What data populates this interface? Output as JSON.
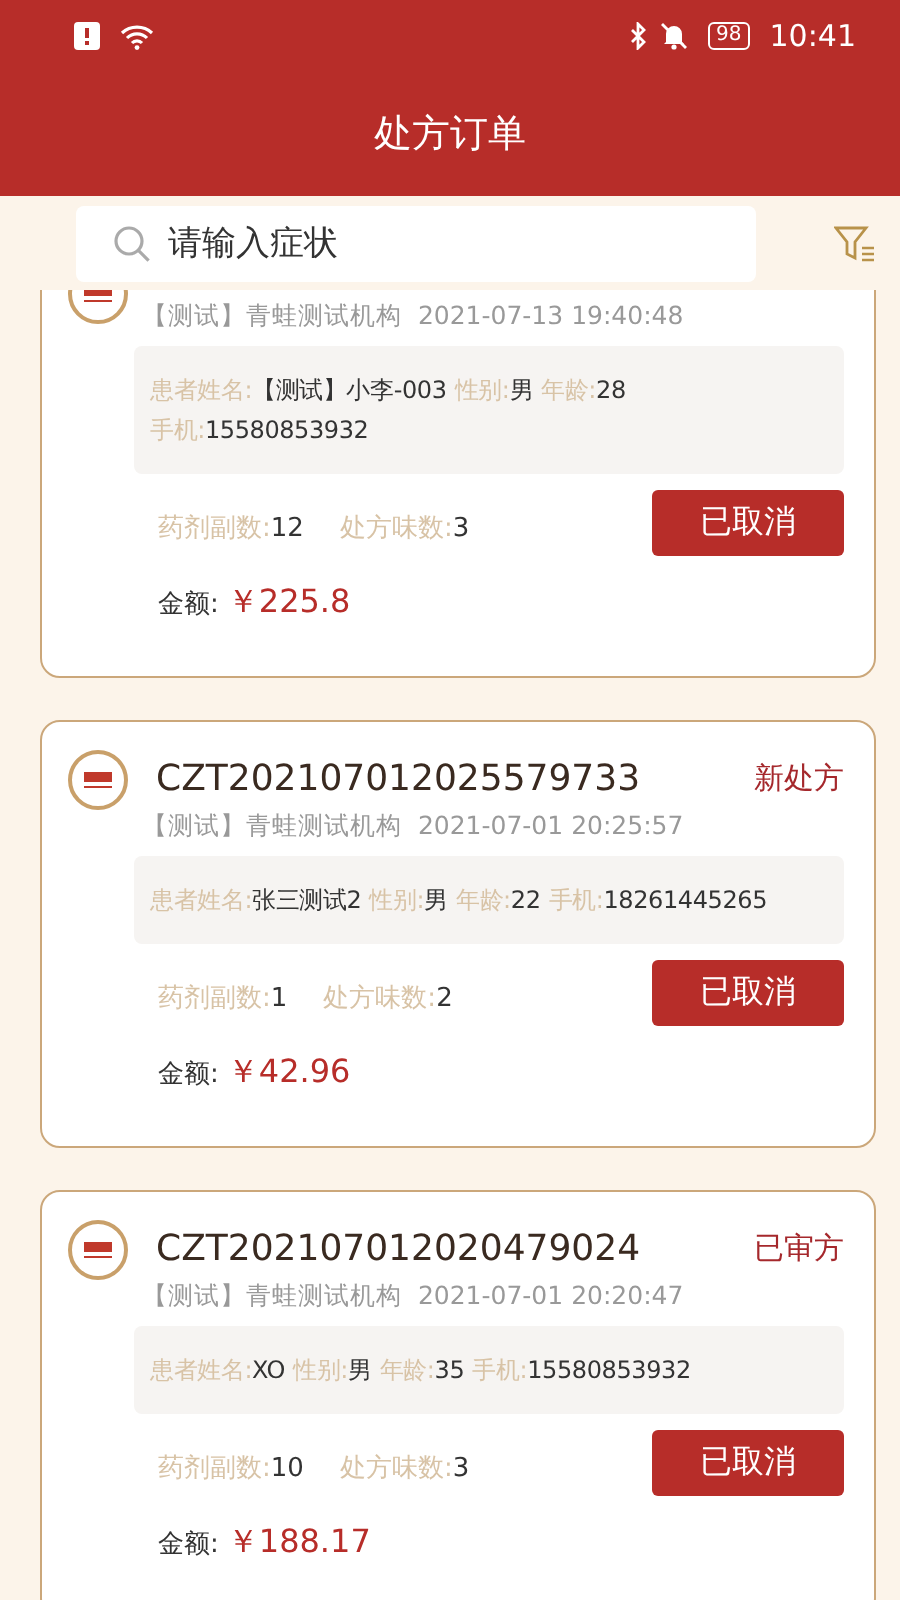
{
  "status_bar": {
    "battery": "98",
    "time": "10:41"
  },
  "header": {
    "title": "处方订单"
  },
  "search": {
    "placeholder": "请输入症状"
  },
  "orders": [
    {
      "org": "【测试】青蛙测试机构",
      "time": "2021-07-13 19:40:48",
      "patient": [
        {
          "label": "患者姓名:",
          "value": "【测试】小李-003"
        },
        {
          "label": "性别:",
          "value": "男"
        },
        {
          "label": "年龄:",
          "value": "28"
        },
        {
          "label": "手机:",
          "value": "15580853932"
        }
      ],
      "counts": [
        {
          "label": "药剂副数:",
          "value": "12"
        },
        {
          "label": "处方味数:",
          "value": "3"
        }
      ],
      "button": "已取消",
      "amount_label": "金额:",
      "amount": "￥225.8"
    },
    {
      "order_no": "CZT202107012025579733",
      "status": "新处方",
      "org": "【测试】青蛙测试机构",
      "time": "2021-07-01 20:25:57",
      "patient": [
        {
          "label": "患者姓名:",
          "value": "张三测试2"
        },
        {
          "label": "性别:",
          "value": "男"
        },
        {
          "label": "年龄:",
          "value": "22"
        },
        {
          "label": "手机:",
          "value": "18261445265"
        }
      ],
      "counts": [
        {
          "label": "药剂副数:",
          "value": "1"
        },
        {
          "label": "处方味数:",
          "value": "2"
        }
      ],
      "button": "已取消",
      "amount_label": "金额:",
      "amount": "￥42.96"
    },
    {
      "order_no": "CZT202107012020479024",
      "status": "已审方",
      "org": "【测试】青蛙测试机构",
      "time": "2021-07-01 20:20:47",
      "patient": [
        {
          "label": "患者姓名:",
          "value": "XO"
        },
        {
          "label": "性别:",
          "value": "男"
        },
        {
          "label": "年龄:",
          "value": "35"
        },
        {
          "label": "手机:",
          "value": "15580853932"
        }
      ],
      "counts": [
        {
          "label": "药剂副数:",
          "value": "10"
        },
        {
          "label": "处方味数:",
          "value": "3"
        }
      ],
      "button": "已取消",
      "amount_label": "金额:",
      "amount": "￥188.17"
    }
  ]
}
